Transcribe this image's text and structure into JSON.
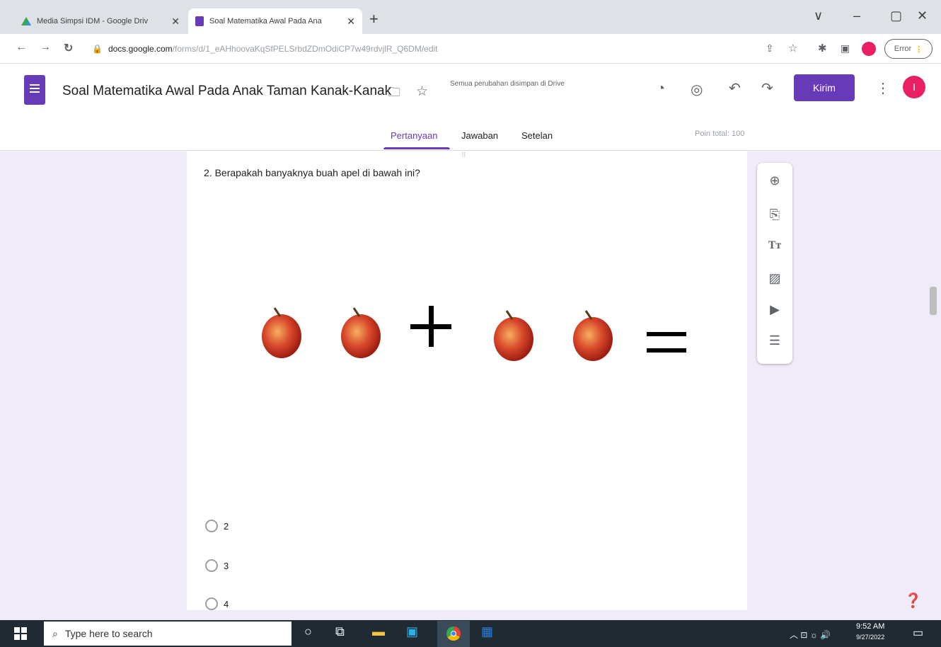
{
  "browser": {
    "tabs": [
      {
        "label": "Media Simpsi IDM - Google Driv",
        "close": "✕"
      },
      {
        "label": "Soal Matematika Awal Pada Ana",
        "close": "✕"
      }
    ],
    "new_tab": "+",
    "url_domain": "docs.google.com",
    "url_path": "/forms/d/1_eAHhoovaKqSfPELSrbdZDmOdiCP7w49rdvjlR_Q6DM/edit",
    "error_label": "Error",
    "window_controls": [
      "∨",
      "–",
      "▢",
      "✕"
    ]
  },
  "forms": {
    "title": "Soal Matematika Awal Pada Anak Taman Kanak-Kanak",
    "saved_status": "Semua perubahan disimpan di Drive",
    "send_label": "Kirim",
    "avatar_letter": "I",
    "tabs": [
      "Pertanyaan",
      "Jawaban",
      "Setelan"
    ],
    "active_tab": "Pertanyaan",
    "points_label": "Poin total: 100",
    "accent": "#673ab7",
    "background": "#f0ebf8"
  },
  "question": {
    "text": "2. Berapakah banyaknya buah apel di bawah ini?",
    "image_icons": [
      "apple",
      "apple",
      "plus-sign",
      "apple",
      "apple",
      "equals-sign"
    ],
    "options": [
      "2",
      "3",
      "4"
    ]
  },
  "side_toolbar": [
    "add-question-icon",
    "import-questions-icon",
    "add-title-icon",
    "add-image-icon",
    "add-video-icon",
    "add-section-icon"
  ],
  "taskbar": {
    "search_placeholder": "Type here to search",
    "time": "9:52 AM",
    "date": "9/27/2022"
  }
}
